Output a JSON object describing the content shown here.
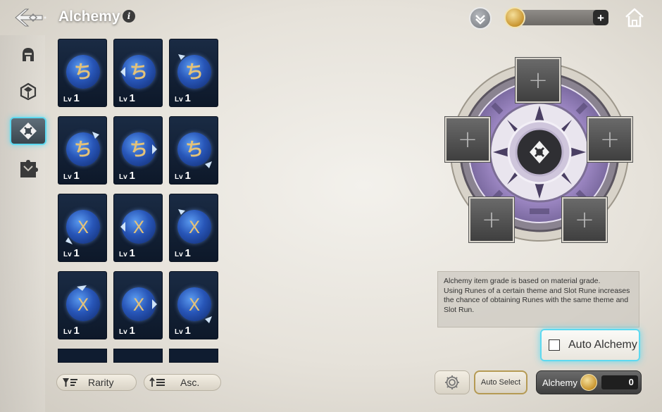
{
  "header": {
    "title": "Alchemy",
    "info_icon": "i",
    "currency_plus": "+",
    "icons": [
      "back-arrow-icon",
      "download-icon",
      "gold-coin-icon",
      "home-icon"
    ]
  },
  "sidebar": {
    "items": [
      {
        "name": "helmet",
        "icon": "helmet-icon",
        "active": false
      },
      {
        "name": "rune-dice",
        "icon": "rune-dice-icon",
        "active": false
      },
      {
        "name": "alchemy",
        "icon": "alchemy-rune-icon",
        "active": true
      },
      {
        "name": "puzzle",
        "icon": "puzzle-icon",
        "active": false
      }
    ]
  },
  "runes": {
    "rows": [
      [
        {
          "symbol": "ち",
          "lv_label": "Lv",
          "level": "1"
        },
        {
          "symbol": "ち",
          "lv_label": "Lv",
          "level": "1"
        },
        {
          "symbol": "ち",
          "lv_label": "Lv",
          "level": "1"
        }
      ],
      [
        {
          "symbol": "ち",
          "lv_label": "Lv",
          "level": "1"
        },
        {
          "symbol": "ち",
          "lv_label": "Lv",
          "level": "1"
        },
        {
          "symbol": "ち",
          "lv_label": "Lv",
          "level": "1"
        }
      ],
      [
        {
          "symbol": "X",
          "lv_label": "Lv",
          "level": "1"
        },
        {
          "symbol": "X",
          "lv_label": "Lv",
          "level": "1"
        },
        {
          "symbol": "X",
          "lv_label": "Lv",
          "level": "1"
        }
      ],
      [
        {
          "symbol": "X",
          "lv_label": "Lv",
          "level": "1"
        },
        {
          "symbol": "X",
          "lv_label": "Lv",
          "level": "1"
        },
        {
          "symbol": "X",
          "lv_label": "Lv",
          "level": "1"
        }
      ]
    ]
  },
  "sort": {
    "rarity_label": "Rarity",
    "order_label": "Asc."
  },
  "alchemy_circle": {
    "slots": [
      "+",
      "+",
      "+",
      "+",
      "+"
    ],
    "center_icon": "alchemy-rune-icon"
  },
  "info_text": "Alchemy item grade is based on material grade.\nUsing Runes of a certain theme and Slot Rune increases the chance of obtaining Runes with the same theme and Slot Run.",
  "auto_alchemy": {
    "label": "Auto Alchemy",
    "checked": false
  },
  "footer": {
    "auto_select_label": "Auto Select",
    "alchemy_label": "Alchemy",
    "cost": "0"
  },
  "colors": {
    "highlight": "#5ed9f0",
    "card_bg": "#13223a",
    "rune_gold": "#e3c27a"
  }
}
